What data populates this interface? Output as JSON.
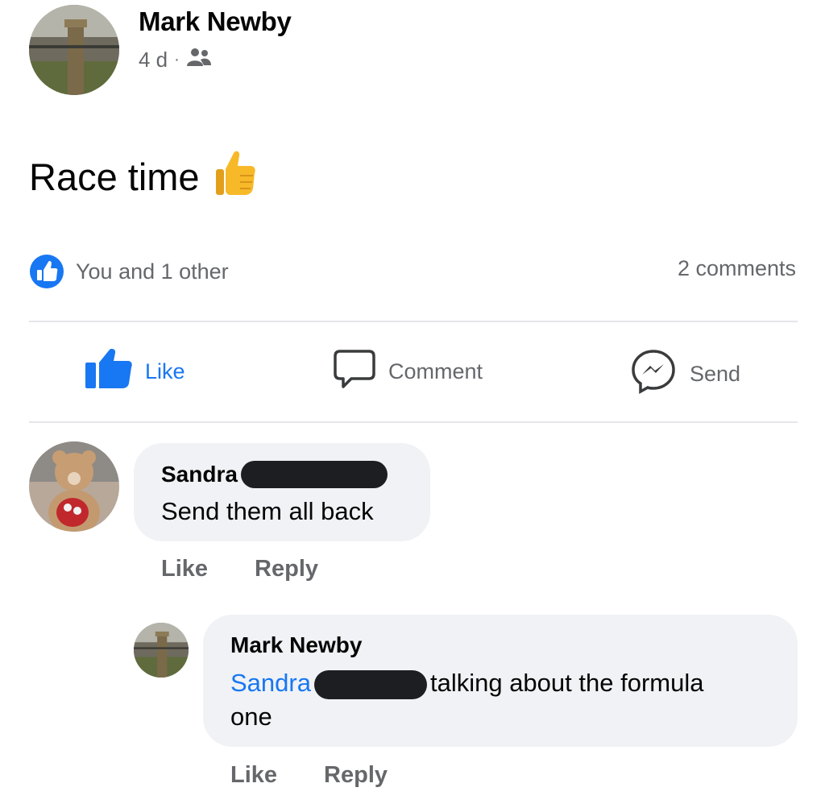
{
  "post": {
    "author": "Mark Newby",
    "time": "4 d",
    "separator": "·",
    "audience_icon": "friends-icon",
    "text": "Race time",
    "emoji": "👍"
  },
  "reactions": {
    "summary": "You and 1 other",
    "comments_count": "2 comments"
  },
  "actions": {
    "like": "Like",
    "comment": "Comment",
    "send": "Send"
  },
  "comments": [
    {
      "author": "Sandra",
      "text": "Send them all back",
      "like": "Like",
      "reply": "Reply"
    },
    {
      "author": "Mark Newby",
      "mention": "Sandra",
      "text_line1": "talking about the formula",
      "text_line2": "one",
      "like": "Like",
      "reply": "Reply"
    }
  ],
  "colors": {
    "accent": "#1877f2",
    "secondary_text": "#65676b",
    "bubble": "#f0f2f5"
  }
}
